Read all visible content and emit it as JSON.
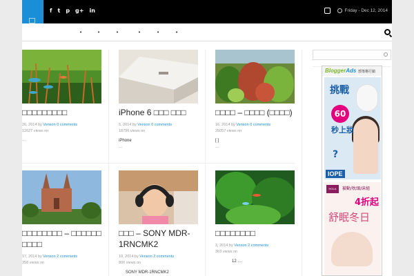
{
  "topbar": {
    "social_icons": [
      "facebook-icon",
      "twitter-icon",
      "pinterest-icon",
      "googleplus-icon",
      "linkedin-icon"
    ],
    "social_glyphs": [
      "f",
      "t",
      "p",
      "g+",
      "in"
    ],
    "date": "Friday - Dec 12, 2014"
  },
  "nav": {
    "items": [
      "•",
      "•",
      "•",
      "•",
      "•",
      "•"
    ]
  },
  "posts": [
    {
      "title": "□□□□□□□□□",
      "date": "26, 2014",
      "by": "by",
      "author": "Venson",
      "comments": "0 comments",
      "views": "12627 views on",
      "excerpt": "",
      "more": "..."
    },
    {
      "title": "iPhone 6 □□□ □□□",
      "date": "5, 2014",
      "by": "by",
      "author": "Venson",
      "comments": "0 comments",
      "views": "18796 views on",
      "excerpt": "iPhone",
      "more": "..."
    },
    {
      "title": "□□□□ – □□□□ (□□□□)",
      "date": "16, 2014",
      "by": "by",
      "author": "Venson",
      "comments": "0 comments",
      "views": "25057 views on",
      "excerpt": "[ ]",
      "more": "..."
    },
    {
      "title": "□□□□□□□□ – □□□□□□ □□□□",
      "date": "17, 2014",
      "by": "by",
      "author": "Venson",
      "comments": "2 comments",
      "views": "358 views on",
      "excerpt": "",
      "more": ""
    },
    {
      "title": "□□□ – SONY MDR-1RNCMK2",
      "date": "10, 2014",
      "by": "by",
      "author": "Venson",
      "comments": "2 comments",
      "views": "806 views on",
      "excerpt": "SONY MDR-1RNCMK2",
      "more": ""
    },
    {
      "title": "□□□□□□□□",
      "date": "3, 2014",
      "by": "by",
      "author": "Venson",
      "comments": "2 comments",
      "views": "363 views on",
      "excerpt": "12 ....",
      "more": ""
    }
  ],
  "ad": {
    "brand_a": "Blogger",
    "brand_b": "Ads",
    "brand_sub": "部落格行銷",
    "a1_big": "挑戰",
    "a1_num": "60",
    "a1_text": "秒上妝",
    "a1_q": "?",
    "a1_logo": "IOPE",
    "a2_logo": "HOLA",
    "a2_line1": "被動/枕頭/床組",
    "a2_num": "4折起",
    "a2_big": "舒眠冬日",
    "a2_bottom": ""
  },
  "colors": {
    "accent": "#1a8fd8",
    "topbar": "#000000",
    "page_bg": "#ebebeb"
  }
}
